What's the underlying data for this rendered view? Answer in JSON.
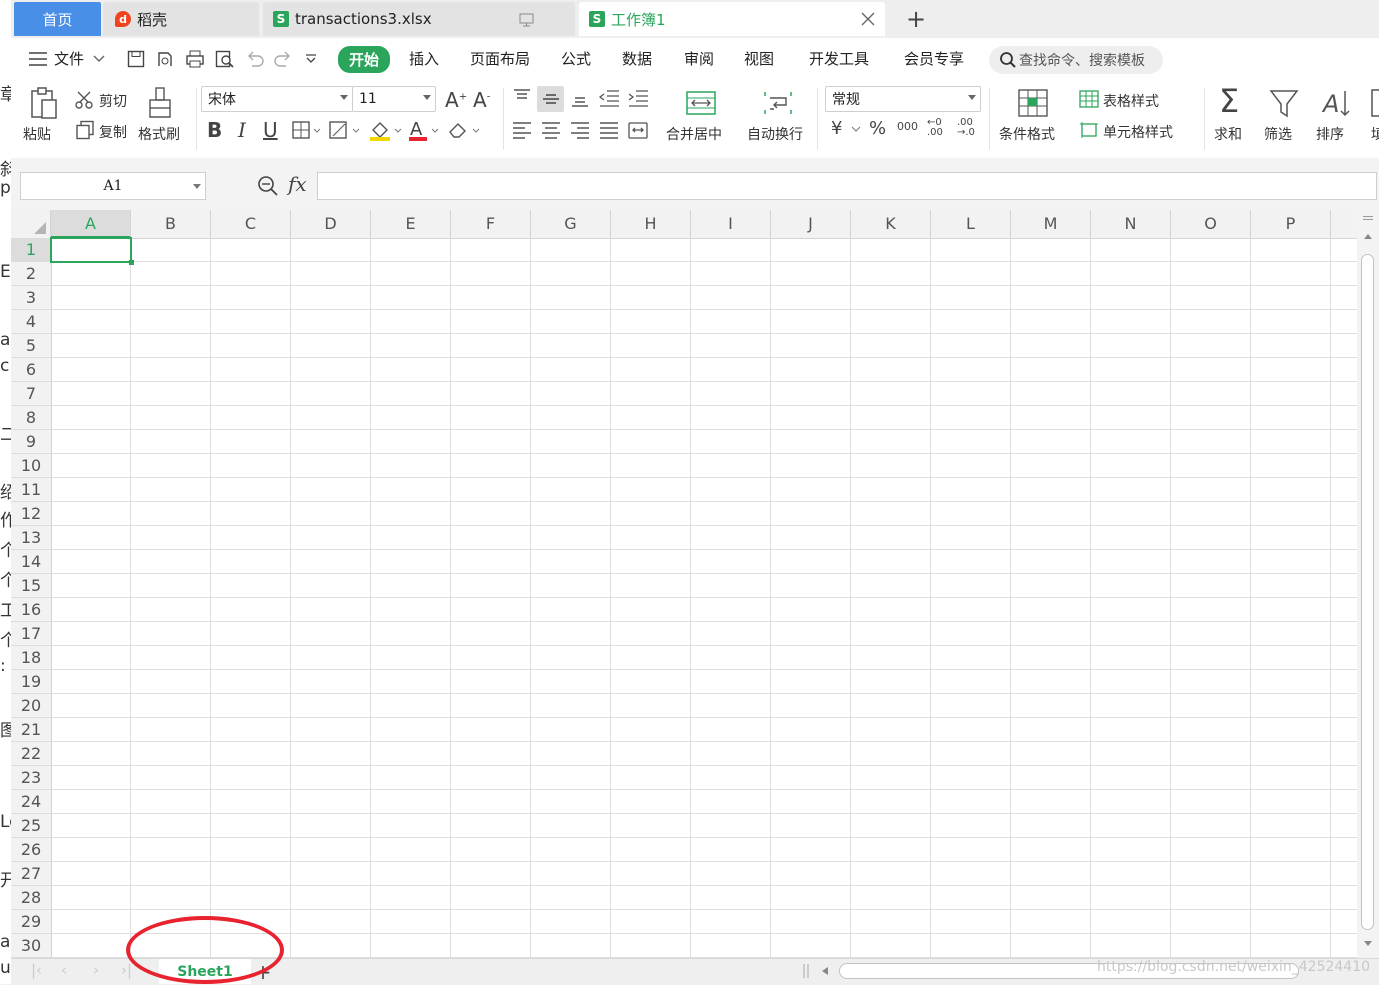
{
  "left_strip_text": [
    "章",
    "斜",
    "p",
    "E",
    "a",
    "c",
    "二",
    "绍",
    "作",
    "个",
    "个",
    "工",
    "个",
    ":",
    "图",
    "Lo",
    "开",
    "a",
    "ub"
  ],
  "tabs": {
    "home": "首页",
    "daoke": "稻壳",
    "file1": "transactions3.xlsx",
    "file2": "工作簿1",
    "new_tab": "+"
  },
  "menu": {
    "file": "文件",
    "items": [
      "开始",
      "插入",
      "页面布局",
      "公式",
      "数据",
      "审阅",
      "视图",
      "开发工具",
      "会员专享"
    ],
    "search_placeholder": "查找命令、搜索模板"
  },
  "ribbon": {
    "cut": "剪切",
    "copy": "复制",
    "paste": "粘贴",
    "format_painter": "格式刷",
    "font_name": "宋体",
    "font_size": "11",
    "merge_center": "合并居中",
    "wrap_text": "自动换行",
    "number_format": "常规",
    "conditional_format": "条件格式",
    "table_style": "表格样式",
    "cell_style": "单元格样式",
    "sum": "求和",
    "filter": "筛选",
    "sort": "排序",
    "fill": "填"
  },
  "formula_bar": {
    "name_box": "A1",
    "fx": "fx",
    "value": ""
  },
  "sheet": {
    "columns": [
      "A",
      "B",
      "C",
      "D",
      "E",
      "F",
      "G",
      "H",
      "I",
      "J",
      "K",
      "L",
      "M",
      "N",
      "O",
      "P"
    ],
    "rows": [
      "1",
      "2",
      "3",
      "4",
      "5",
      "6",
      "7",
      "8",
      "9",
      "10",
      "11",
      "12",
      "13",
      "14",
      "15",
      "16",
      "17",
      "18",
      "19",
      "20",
      "21",
      "22",
      "23",
      "24",
      "25",
      "26",
      "27",
      "28",
      "29",
      "30"
    ],
    "active_cell": "A1"
  },
  "sheet_tabs": {
    "tab": "Sheet1",
    "add": "+"
  },
  "watermark": "https://blog.csdn.net/weixin_42524410",
  "colors": {
    "accent_green": "#2aa55b",
    "home_tab_blue": "#4a8fe7",
    "annotation_red": "#e8222e"
  }
}
